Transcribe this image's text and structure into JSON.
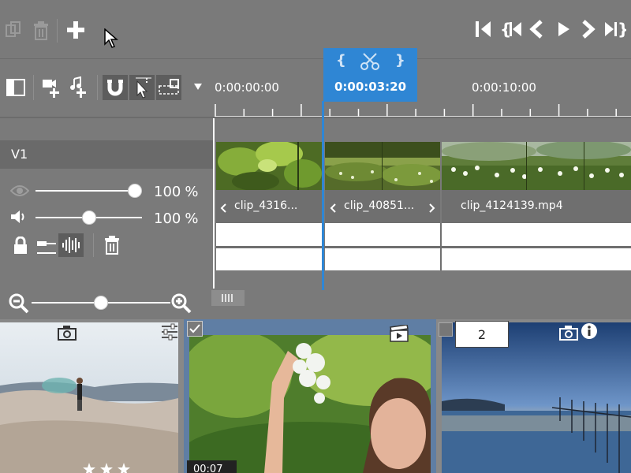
{
  "toolbar": {
    "copy_icon": "copy-icon",
    "delete_icon": "trash-icon",
    "add_icon": "plus-icon",
    "nav_icons": [
      "skip-to-start-icon",
      "prev-marker-icon",
      "prev-frame-icon",
      "play-icon",
      "next-frame-icon",
      "skip-to-end-icon"
    ]
  },
  "timeline": {
    "ruler_labels": [
      "0:00:00:00",
      "0:00:10:00"
    ],
    "playhead_time": "0:00:03:20",
    "playhead_icons": [
      "{",
      "scissors-icon",
      "}"
    ]
  },
  "track": {
    "name": "V1",
    "opacity_percent": "100",
    "volume_percent": "100",
    "percent_sign": "%",
    "opacity_level": 1.0,
    "volume_level": 0.5
  },
  "clips": [
    {
      "label": "clip_4316...",
      "start_arrow": true
    },
    {
      "label": "clip_40851...",
      "start_arrow": true,
      "end_arrow": true
    },
    {
      "label": "clip_4124139.mp4"
    }
  ],
  "zoom": {
    "level": 0.5
  },
  "media": {
    "items": [
      {
        "kind": "photo",
        "rating_stars": 3
      },
      {
        "kind": "video",
        "duration": "00:07",
        "checked": true
      },
      {
        "kind": "photo",
        "badge": "2"
      }
    ]
  },
  "colors": {
    "accent": "#2f86d4",
    "background": "#7a7a7a",
    "panel": "#888888"
  }
}
